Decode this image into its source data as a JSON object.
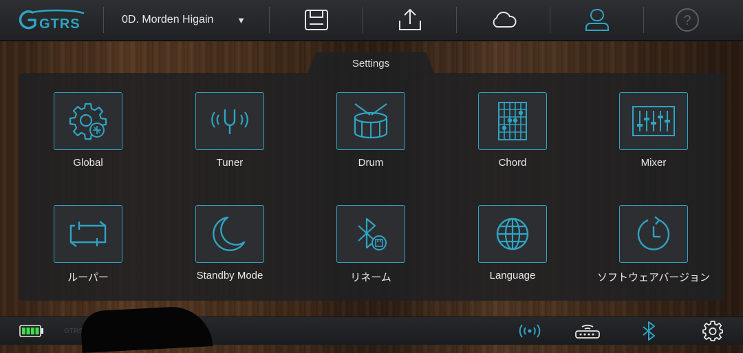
{
  "header": {
    "logo_text": "GTRS",
    "preset_name": "0D. Morden Higain",
    "icons": [
      "save-icon",
      "upload-icon",
      "cloud-icon",
      "user-icon",
      "help-icon"
    ]
  },
  "panel": {
    "title": "Settings",
    "items": [
      {
        "label": "Global",
        "icon": "gear-icon"
      },
      {
        "label": "Tuner",
        "icon": "tuning-fork-icon"
      },
      {
        "label": "Drum",
        "icon": "drum-icon"
      },
      {
        "label": "Chord",
        "icon": "chord-chart-icon"
      },
      {
        "label": "Mixer",
        "icon": "mixer-icon"
      },
      {
        "label": "ルーパー",
        "icon": "loop-icon"
      },
      {
        "label": "Standby Mode",
        "icon": "moon-icon"
      },
      {
        "label": "リネーム",
        "icon": "bluetooth-rename-icon"
      },
      {
        "label": "Language",
        "icon": "globe-icon"
      },
      {
        "label": "ソフトウェアバージョン",
        "icon": "clock-refresh-icon"
      }
    ]
  },
  "footer": {
    "small_text": "GTRS",
    "battery_level": 1.0,
    "icons": [
      "battery-icon",
      "wireless-signal-icon",
      "router-icon",
      "bluetooth-icon",
      "settings-gear-icon"
    ]
  },
  "colors": {
    "accent": "#2fa4c4",
    "battery": "#3ee04a",
    "panel_bg": "#202123"
  }
}
